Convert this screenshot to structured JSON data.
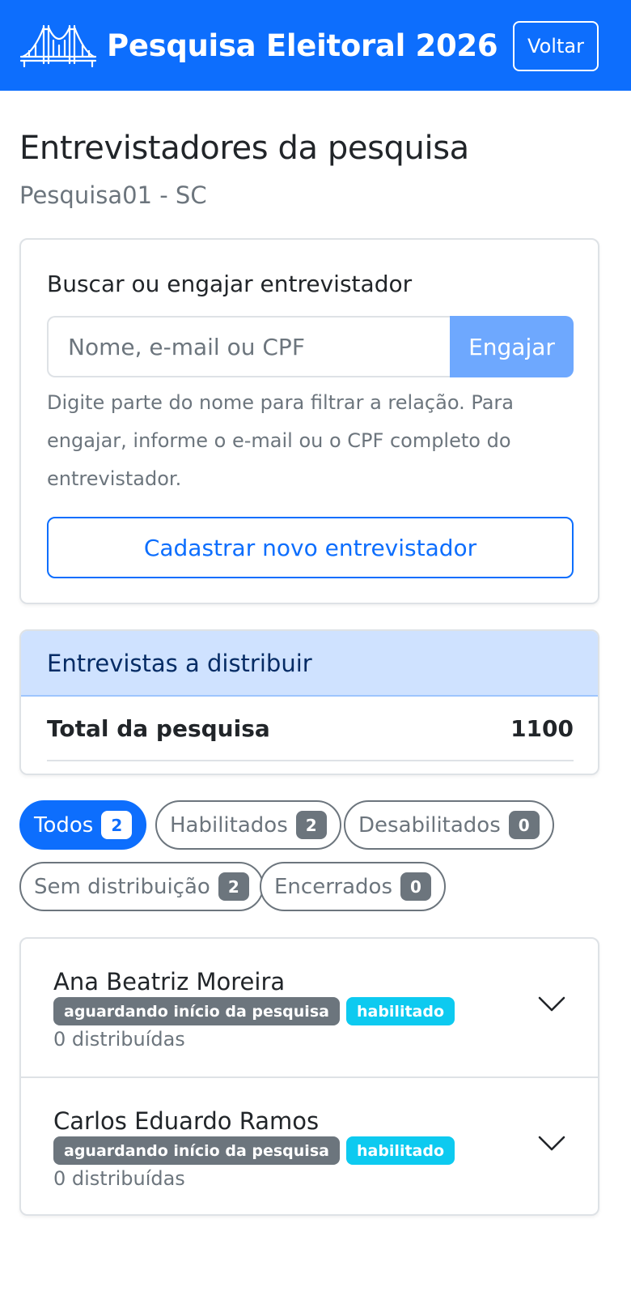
{
  "header": {
    "title": "Pesquisa Eleitoral 2026",
    "back_label": "Voltar"
  },
  "page": {
    "title": "Entrevistadores da pesquisa",
    "subtitle": "Pesquisa01 - SC"
  },
  "search_card": {
    "title": "Buscar ou engajar entrevistador",
    "input_value": "",
    "input_placeholder": "Nome, e-mail ou CPF",
    "engage_label": "Engajar",
    "help_text": "Digite parte do nome para filtrar a relação. Para engajar, informe o e-mail ou o CPF completo do entrevistador.",
    "register_label": "Cadastrar novo entrevistador"
  },
  "distribution_card": {
    "title": "Entrevistas a distribuir",
    "row_label": "Total da pesquisa",
    "row_value": "1100"
  },
  "filters": [
    {
      "label": "Todos",
      "count": "2",
      "active": true
    },
    {
      "label": "Habilitados",
      "count": "2",
      "active": false
    },
    {
      "label": "Desabilitados",
      "count": "0",
      "active": false
    },
    {
      "label": "Sem distribuição",
      "count": "2",
      "active": false
    },
    {
      "label": "Encerrados",
      "count": "0",
      "active": false
    }
  ],
  "interviewers": [
    {
      "name": "Ana Beatriz Moreira",
      "status_badge": "aguardando início da pesquisa",
      "enabled_badge": "habilitado",
      "distributed": "0 distribuídas"
    },
    {
      "name": "Carlos Eduardo Ramos",
      "status_badge": "aguardando início da pesquisa",
      "enabled_badge": "habilitado",
      "distributed": "0 distribuídas"
    }
  ],
  "colors": {
    "primary": "#0d6efd",
    "secondary": "#6c757d",
    "info": "#0dcaf0",
    "header_tint": "#cfe2ff"
  },
  "icons": {
    "logo": "bridge-logo-icon",
    "expand": "chevron-down-icon"
  }
}
